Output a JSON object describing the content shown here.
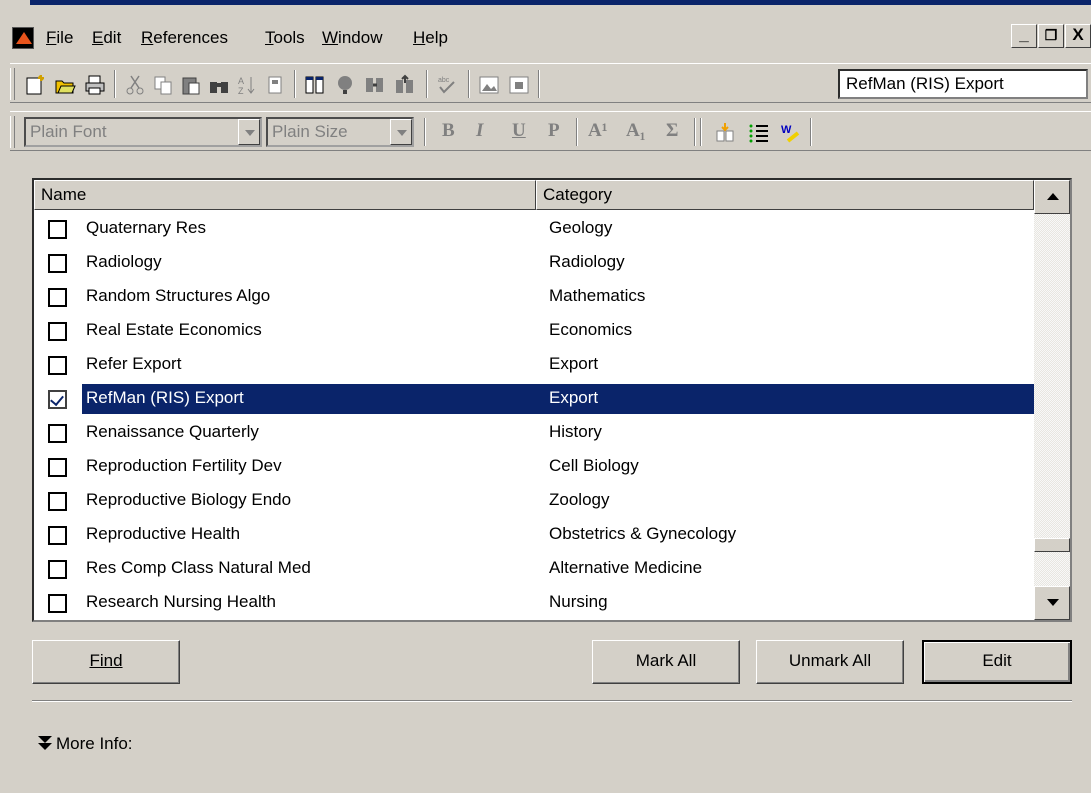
{
  "menubar": {
    "items": [
      {
        "label": "File",
        "accel": "F"
      },
      {
        "label": "Edit",
        "accel": "E"
      },
      {
        "label": "References",
        "accel": "R"
      },
      {
        "label": "Tools",
        "accel": "T"
      },
      {
        "label": "Window",
        "accel": "W"
      },
      {
        "label": "Help",
        "accel": "H"
      }
    ],
    "window_buttons": [
      "_",
      "❐",
      "X"
    ]
  },
  "toolbar1": {
    "style_select_value": "RefMan (RIS) Export"
  },
  "toolbar2": {
    "font_value": "Plain Font",
    "size_value": "Plain Size",
    "bold": "B",
    "italic": "I",
    "underline": "U",
    "plain": "P",
    "superscript": "A¹",
    "subscript": "A₁",
    "symbol": "Σ"
  },
  "list": {
    "columns": [
      "Name",
      "Category"
    ],
    "rows": [
      {
        "name": "Quaternary Res",
        "category": "Geology",
        "checked": false,
        "selected": false
      },
      {
        "name": "Radiology",
        "category": "Radiology",
        "checked": false,
        "selected": false
      },
      {
        "name": "Random Structures Algo",
        "category": "Mathematics",
        "checked": false,
        "selected": false
      },
      {
        "name": "Real Estate Economics",
        "category": "Economics",
        "checked": false,
        "selected": false
      },
      {
        "name": "Refer Export",
        "category": "Export",
        "checked": false,
        "selected": false
      },
      {
        "name": "RefMan (RIS) Export",
        "category": "Export",
        "checked": true,
        "selected": true
      },
      {
        "name": "Renaissance Quarterly",
        "category": "History",
        "checked": false,
        "selected": false
      },
      {
        "name": "Reproduction Fertility Dev",
        "category": "Cell Biology",
        "checked": false,
        "selected": false
      },
      {
        "name": "Reproductive Biology Endo",
        "category": "Zoology",
        "checked": false,
        "selected": false
      },
      {
        "name": "Reproductive Health",
        "category": "Obstetrics & Gynecology",
        "checked": false,
        "selected": false
      },
      {
        "name": "Res Comp Class Natural Med",
        "category": "Alternative Medicine",
        "checked": false,
        "selected": false
      },
      {
        "name": "Research Nursing Health",
        "category": "Nursing",
        "checked": false,
        "selected": false
      }
    ]
  },
  "buttons": {
    "find": "Find",
    "mark_all": "Mark All",
    "unmark_all": "Unmark All",
    "edit": "Edit"
  },
  "more_info": "More Info:",
  "colors": {
    "selection": "#0a246a",
    "face": "#d4d0c8"
  }
}
